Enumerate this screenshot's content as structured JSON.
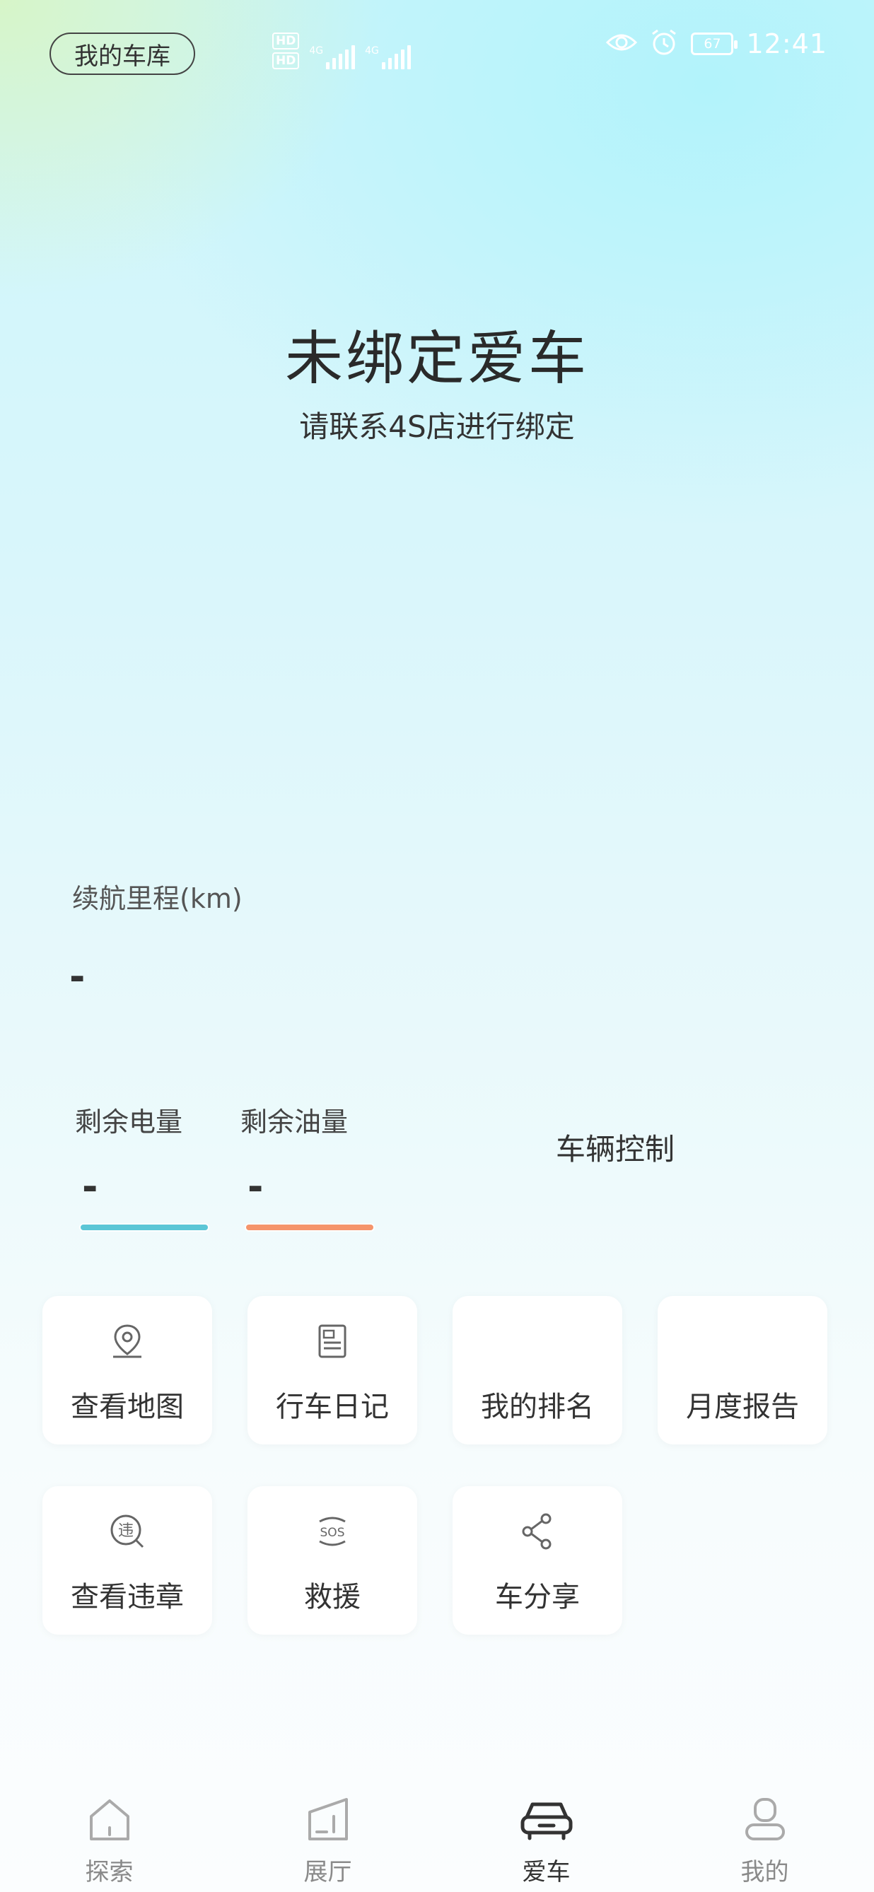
{
  "status_bar": {
    "garage_button": "我的车库",
    "hd1": "HD",
    "hd2": "HD",
    "net1": "4G",
    "net2": "4G",
    "battery": "67",
    "time": "12:41"
  },
  "header": {
    "title": "未绑定爱车",
    "subtitle": "请联系4S店进行绑定"
  },
  "range": {
    "label": "续航里程(km)",
    "value": "-"
  },
  "meters": [
    {
      "label": "剩余电量",
      "value": "-",
      "color": "#5bc6d6"
    },
    {
      "label": "剩余油量",
      "value": "-",
      "color": "#f5946b"
    }
  ],
  "vehicle_control_label": "车辆控制",
  "grid": [
    {
      "label": "查看地图",
      "icon": "map-pin-icon"
    },
    {
      "label": "行车日记",
      "icon": "diary-icon"
    },
    {
      "label": "我的排名",
      "icon": ""
    },
    {
      "label": "月度报告",
      "icon": ""
    },
    {
      "label": "查看违章",
      "icon": "violation-icon"
    },
    {
      "label": "救援",
      "icon": "sos-icon"
    },
    {
      "label": "车分享",
      "icon": "share-icon"
    }
  ],
  "nav": [
    {
      "label": "探索",
      "icon": "home-icon"
    },
    {
      "label": "展厅",
      "icon": "showroom-icon"
    },
    {
      "label": "爱车",
      "icon": "car-icon",
      "active": true
    },
    {
      "label": "我的",
      "icon": "profile-icon"
    }
  ]
}
